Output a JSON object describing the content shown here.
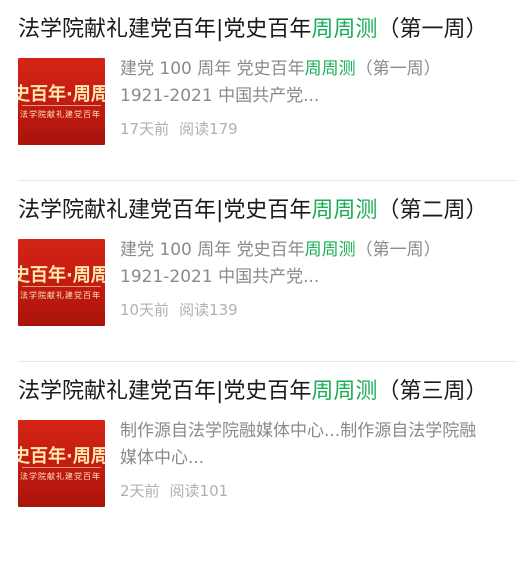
{
  "articles": [
    {
      "title_pre": "法学院献礼建党百年|党史百年",
      "title_hl": "周周测",
      "title_post": "（第一周）",
      "thumb_main": "史百年·周周",
      "thumb_sub": "法学院献礼建党百年",
      "summary_pre": "建党 100 周年 党史百年",
      "summary_hl": "周周测",
      "summary_post": "（第一周）1921-2021 中国共产党...",
      "time": "17天前",
      "reads": "阅读179"
    },
    {
      "title_pre": "法学院献礼建党百年|党史百年",
      "title_hl": "周周测",
      "title_post": "（第二周）",
      "thumb_main": "史百年·周周",
      "thumb_sub": "法学院献礼建党百年",
      "summary_pre": "建党 100 周年 党史百年",
      "summary_hl": "周周测",
      "summary_post": "（第一周）1921-2021 中国共产党...",
      "time": "10天前",
      "reads": "阅读139"
    },
    {
      "title_pre": "法学院献礼建党百年|党史百年",
      "title_hl": "周周测",
      "title_post": "（第三周）",
      "thumb_main": "史百年·周周",
      "thumb_sub": "法学院献礼建党百年",
      "summary_pre": "制作源自法学院融媒体中心...制作源自法学院融媒体中心...",
      "summary_hl": "",
      "summary_post": "",
      "time": "2天前",
      "reads": "阅读101"
    }
  ],
  "colors": {
    "highlight": "#1aad56",
    "thumb_red": "#c8200f",
    "meta_gray": "#b0b0b0"
  }
}
